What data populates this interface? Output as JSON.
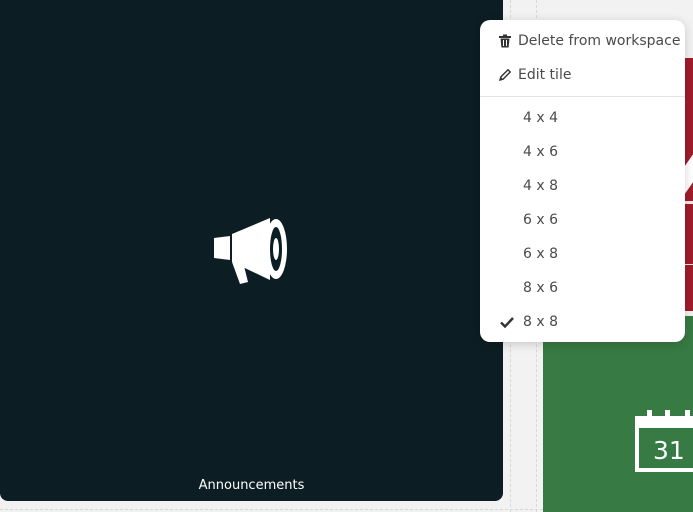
{
  "tile": {
    "title": "Announcements",
    "icon": "megaphone-icon",
    "background": "#0c1e23"
  },
  "side_tiles": {
    "red": {
      "color": "#a01c2c"
    },
    "green": {
      "color": "#377a43",
      "calendar_day": "31",
      "icon": "calendar-icon"
    }
  },
  "menu": {
    "actions": [
      {
        "label": "Delete from workspace",
        "icon": "trash-icon"
      },
      {
        "label": "Edit tile",
        "icon": "pencil-icon"
      }
    ],
    "sizes": [
      {
        "label": "4 x 4",
        "checked": false
      },
      {
        "label": "4 x 6",
        "checked": false
      },
      {
        "label": "4 x 8",
        "checked": false
      },
      {
        "label": "6 x 6",
        "checked": false
      },
      {
        "label": "6 x 8",
        "checked": false
      },
      {
        "label": "8 x 6",
        "checked": false
      },
      {
        "label": "8 x 8",
        "checked": true
      }
    ]
  }
}
